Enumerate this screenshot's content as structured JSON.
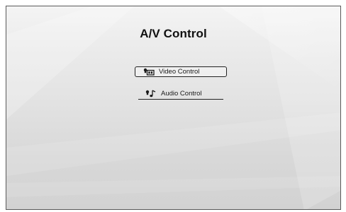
{
  "screen": {
    "title": "A/V Control"
  },
  "menu": {
    "items": [
      {
        "label": "Video Control",
        "icon": "video-control-icon",
        "selected": true
      },
      {
        "label": "Audio Control",
        "icon": "audio-control-icon",
        "selected": false
      }
    ]
  },
  "colors": {
    "background_top": "#f4f4f4",
    "background_bottom": "#d2d2d2",
    "text": "#111111",
    "frame": "#5a5a5a"
  }
}
